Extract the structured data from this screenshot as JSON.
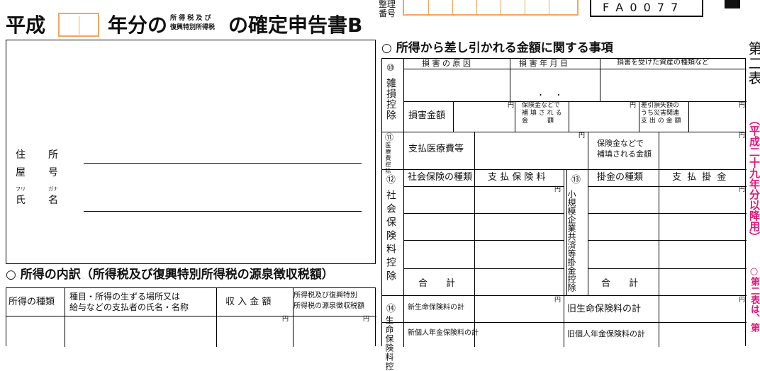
{
  "header": {
    "era": "平成",
    "year_suffix": "年分の",
    "tax_small_1": "所 得 税 及 び",
    "tax_small_2": "復興特別所得税",
    "title_end": "の確定申告書B",
    "seiri_1": "整理",
    "seiri_2": "番号",
    "form_code": "F A 0 0 7 7"
  },
  "address_block": {
    "addr_label_1": "住",
    "addr_label_2": "所",
    "yago_label_1": "屋",
    "yago_label_2": "号",
    "furi": "フリ",
    "gana": "ガナ",
    "name_label_1": "氏",
    "name_label_2": "名"
  },
  "income_section": {
    "title": "○ 所得の内訳（所得税及び復興特別所得税の源泉徴収税額）",
    "col_kind": "所得の種類",
    "col_place_1": "種目・所得の生ずる場所又は",
    "col_place_2": "給与などの支払者の氏名・名称",
    "col_amount": "収 入 金 額",
    "col_tax_1": "所得税及び復興特別",
    "col_tax_2": "所得税の源泉徴収税額",
    "yen": "円"
  },
  "deduction_section": {
    "title": "○ 所得から差し引かれる金額に関する事項",
    "num10": "⑩",
    "label10": "雑損控除",
    "h_cause": "損 害 の 原 因",
    "h_date": "損 害 年 月 日",
    "h_asset": "損害を受けた資産の種類など",
    "date_dots": ".    .",
    "loss_amount": "損害金額",
    "ins_1": "保険金などで",
    "ins_2": "補 填 さ れ る",
    "ins_3": "金　　　額",
    "diff_1": "差引損失額の",
    "diff_2": "うち災害関連",
    "diff_3": "支 出 の 金 額",
    "num11": "⑪",
    "label11": "医療費控除",
    "med_paid": "支払医療費等",
    "med_ins_1": "保険金などで",
    "med_ins_2": "補填される金額",
    "num12": "⑫",
    "label12": "社会保険料控除",
    "social_kind": "社会保険の種類",
    "social_paid": "支 払 保 険 料",
    "num13": "⑬",
    "label13_a": "小規模企業共済等掛金控除",
    "kake_kind": "掛金の種類",
    "kake_paid": "支 払 掛 金",
    "total": "合　　計",
    "num14": "⑭",
    "label14": "生命保険料控",
    "new_life": "新生命保険料の計",
    "old_life": "旧生命保険料の計",
    "new_pension": "新個人年金保険料の計",
    "old_pension": "旧個人年金保険料の計",
    "yen": "円"
  },
  "side_note": {
    "table_2": "第二表",
    "note": "（平成二十九年分以降用）",
    "note2": "○第二表は、第"
  },
  "colors": {
    "accent": "#e0167a",
    "box_orange": "#f3a55b"
  }
}
